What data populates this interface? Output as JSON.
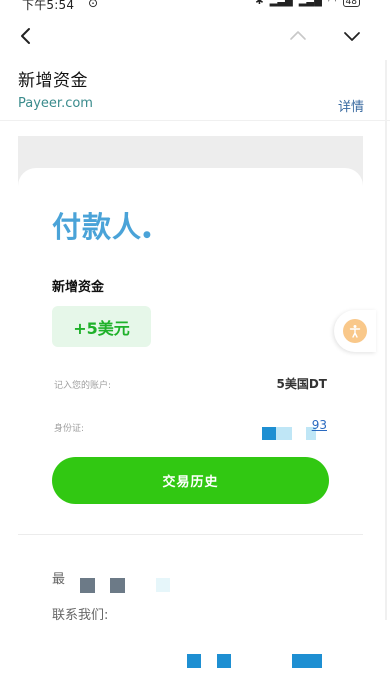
{
  "status_bar": {
    "time": "下午5:54",
    "battery": "48"
  },
  "mail": {
    "subject": "新增资金",
    "sender": "Payeer.com",
    "details_label": "详情"
  },
  "card": {
    "brand": "付款人",
    "title": "新增资金",
    "amount": "+5美元",
    "credited_label": "记入您的账户:",
    "credited_value": "5美国DT",
    "id_label": "身份证:",
    "id_value": "93",
    "history_button": "交易历史",
    "footer_recent": "最",
    "footer_contact": "联系我们:"
  },
  "colors": {
    "brand": "#4aa3d8",
    "button_green": "#31c812",
    "amount_green": "#1fb12a",
    "amount_bg": "#e6f7e9",
    "link_blue": "#2a6ac0"
  },
  "icons": {
    "back": "chevron-left-icon",
    "prev": "chevron-up-icon",
    "next": "chevron-down-icon",
    "accessibility": "accessibility-icon"
  }
}
